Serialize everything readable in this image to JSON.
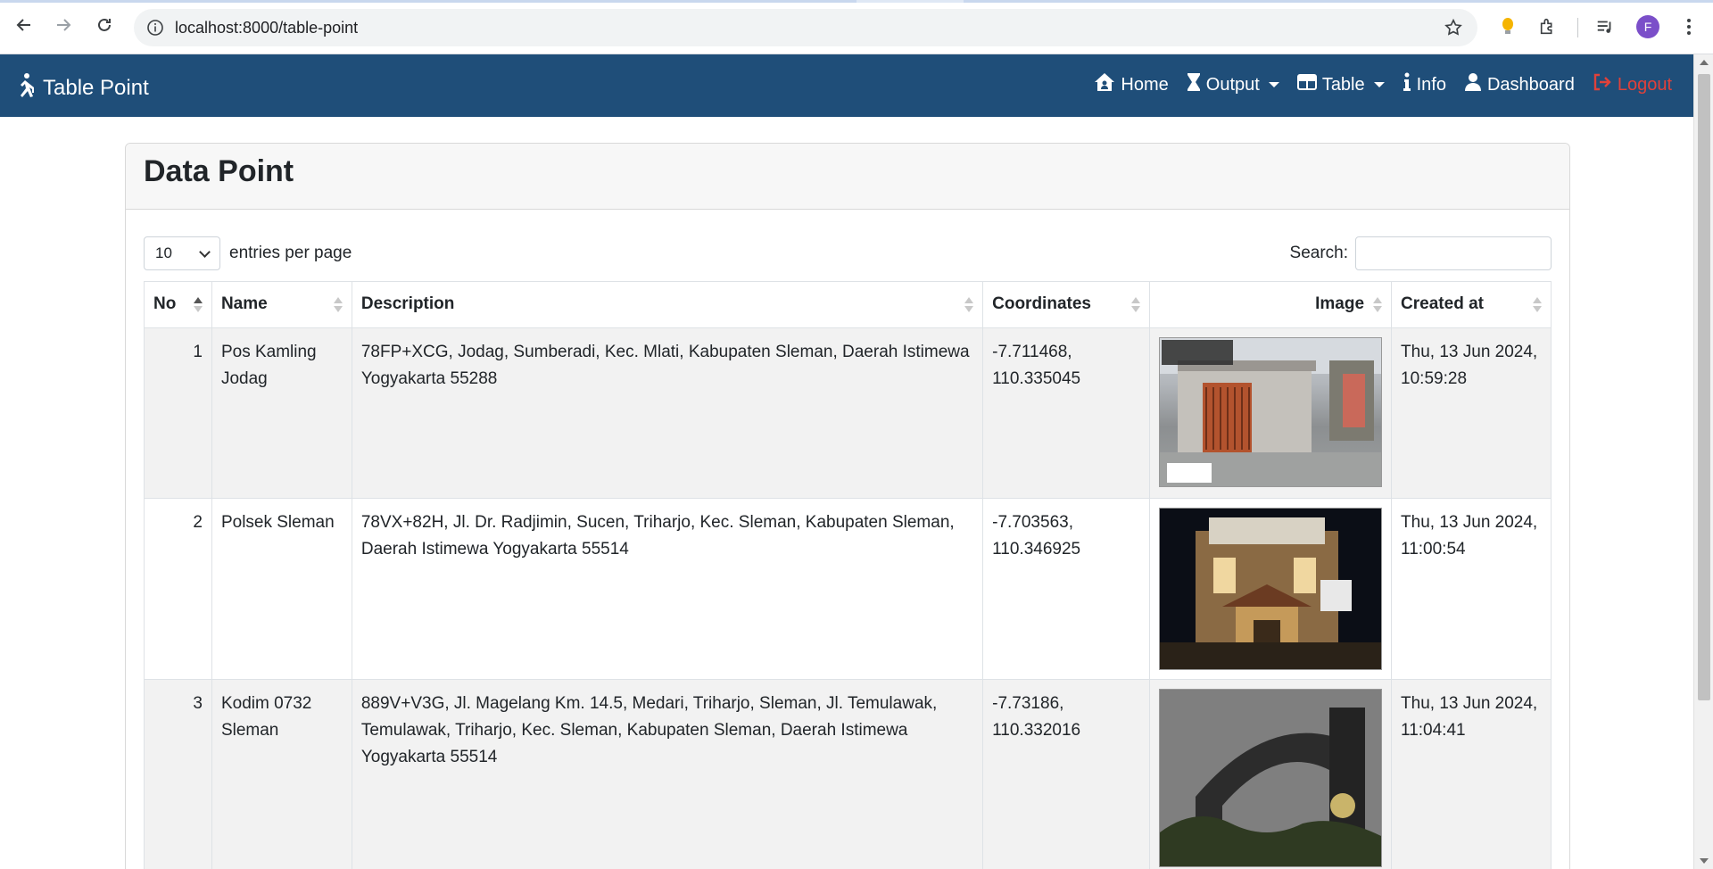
{
  "browser": {
    "url": "localhost:8000/table-point",
    "avatar_letter": "F"
  },
  "navbar": {
    "brand": "Table Point",
    "items": [
      {
        "label": "Home",
        "icon": "house-user-icon"
      },
      {
        "label": "Output",
        "icon": "hourglass-icon",
        "dropdown": true
      },
      {
        "label": "Table",
        "icon": "table-icon",
        "dropdown": true
      },
      {
        "label": "Info",
        "icon": "info-icon"
      },
      {
        "label": "Dashboard",
        "icon": "user-icon"
      },
      {
        "label": "Logout",
        "icon": "sign-out-icon"
      }
    ],
    "bg_color": "#1f4e79",
    "logout_color": "#e0413a"
  },
  "card": {
    "title": "Data Point"
  },
  "controls": {
    "per_page_value": "10",
    "per_page_label": "entries per page",
    "search_label": "Search:",
    "search_value": ""
  },
  "table": {
    "headers": [
      "No",
      "Name",
      "Description",
      "Coordinates",
      "Image",
      "Created at"
    ],
    "rows": [
      {
        "no": "1",
        "name": "Pos Kamling Jodag",
        "description": "78FP+XCG, Jodag, Sumberadi, Kec. Mlati, Kabupaten Sleman, Daerah Istimewa Yogyakarta 55288",
        "coordinates": "-7.711468, 110.335045",
        "created_at": "Thu, 13 Jun 2024, 10:59:28"
      },
      {
        "no": "2",
        "name": "Polsek Sleman",
        "description": "78VX+82H, Jl. Dr. Radjimin, Sucen, Triharjo, Kec. Sleman, Kabupaten Sleman, Daerah Istimewa Yogyakarta 55514",
        "coordinates": "-7.703563, 110.346925",
        "created_at": "Thu, 13 Jun 2024, 11:00:54"
      },
      {
        "no": "3",
        "name": "Kodim 0732 Sleman",
        "description": "889V+V3G, Jl. Magelang Km. 14.5, Medari, Triharjo, Sleman, Jl. Temulawak, Temulawak, Triharjo, Kec. Sleman, Kabupaten Sleman, Daerah Istimewa Yogyakarta 55514",
        "coordinates": "-7.73186, 110.332016",
        "created_at": "Thu, 13 Jun 2024, 11:04:41"
      }
    ]
  }
}
